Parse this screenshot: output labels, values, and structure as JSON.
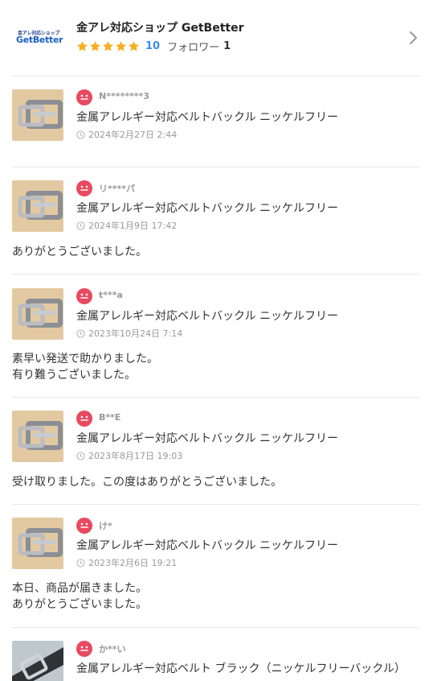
{
  "shop": {
    "logo_line1": "金アレ対応ショップ",
    "logo_line2": "GetBetter",
    "name": "金アレ対応ショップ GetBetter",
    "rating_count": "10",
    "follow_label": "フォロワー",
    "follow_count": "1",
    "stars": 5
  },
  "colors": {
    "star": "#f5b020",
    "accent": "#3a8ee6",
    "avatar": "#e84a5f"
  },
  "icons": {
    "chevron": "chevron-right-icon",
    "avatar": "smiley-face-icon",
    "clock": "clock-icon",
    "star": "star-icon"
  },
  "reviews": [
    {
      "reviewer": "N********3",
      "product": "金属アレルギー対応ベルトバックル ニッケルフリー",
      "date": "2024年2月27日 2:44",
      "comment": ""
    },
    {
      "reviewer": "リ****パ",
      "product": "金属アレルギー対応ベルトバックル ニッケルフリー",
      "date": "2024年1月9日 17:42",
      "comment": "ありがとうございました。"
    },
    {
      "reviewer": "t***a",
      "product": "金属アレルギー対応ベルトバックル ニッケルフリー",
      "date": "2023年10月24日 7:14",
      "comment": "素早い発送で助かりました。\n有り難うございました。"
    },
    {
      "reviewer": "B**E",
      "product": "金属アレルギー対応ベルトバックル ニッケルフリー",
      "date": "2023年8月17日 19:03",
      "comment": "受け取りました。この度はありがとうございました。"
    },
    {
      "reviewer": "け*",
      "product": "金属アレルギー対応ベルトバックル ニッケルフリー",
      "date": "2023年2月6日 19:21",
      "comment": "本日、商品が届きました。\nありがとうございました。"
    },
    {
      "reviewer": "か**い",
      "product": "金属アレルギー対応ベルト ブラック（ニッケルフリーバックル）",
      "date": "",
      "comment": ""
    }
  ]
}
